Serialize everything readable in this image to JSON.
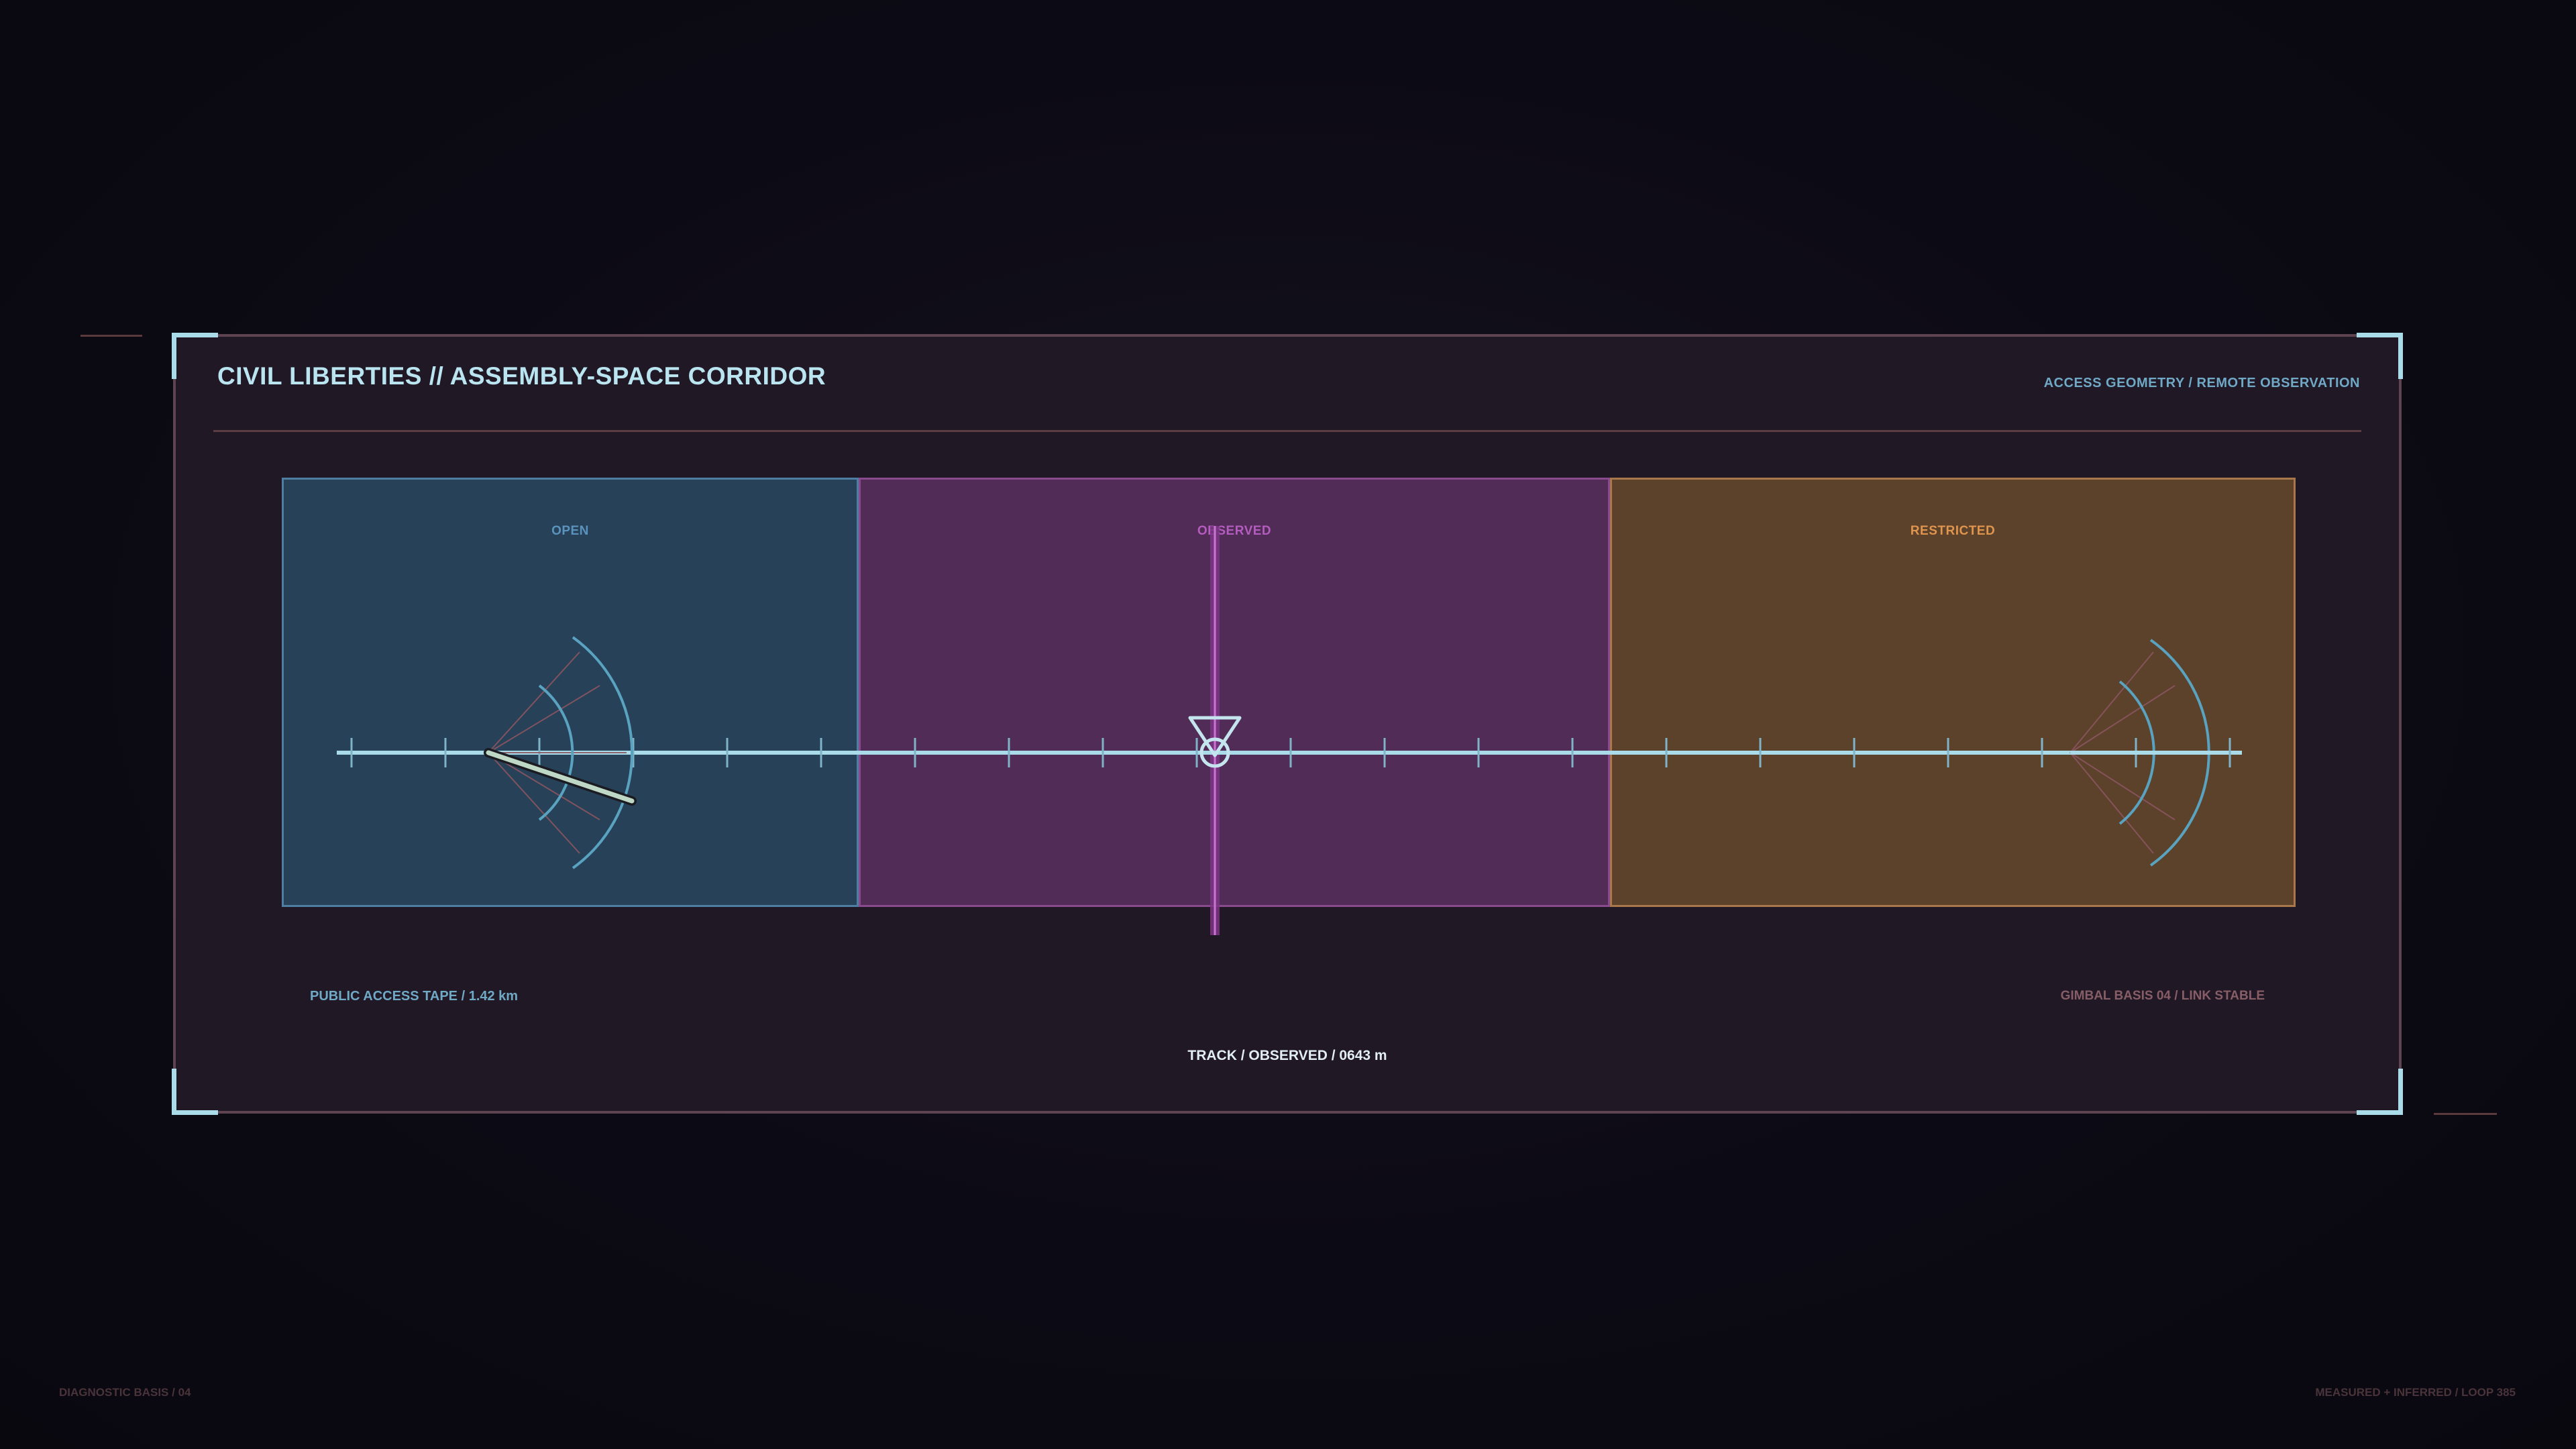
{
  "panel": {
    "title": "CIVIL LIBERTIES // ASSEMBLY-SPACE CORRIDOR",
    "subtitle": "ACCESS GEOMETRY / REMOTE OBSERVATION"
  },
  "zones": [
    {
      "id": "open",
      "label": "OPEN",
      "color": "#5b93bf"
    },
    {
      "id": "observed",
      "label": "OBSERVED",
      "color": "#b55cc0"
    },
    {
      "id": "restricted",
      "label": "RESTRICTED",
      "color": "#e0954f"
    }
  ],
  "readouts": {
    "tape": "PUBLIC ACCESS TAPE / 1.42 km",
    "gimbal": "GIMBAL BASIS 04 / LINK STABLE",
    "track": "TRACK / OBSERVED / 0643 m"
  },
  "footer": {
    "left": "DIAGNOSTIC BASIS / 04",
    "right": "MEASURED + INFERRED / LOOP 385"
  },
  "colors": {
    "rail": "#a9dbe8",
    "marker": "#b55cc0",
    "sensor": "#5aa3c0",
    "sensor_ray": "#8a5560"
  },
  "icons": {
    "left_sensor": "fan-sensor-icon",
    "right_sensor": "fan-sensor-icon",
    "observer": "observer-marker-icon"
  }
}
